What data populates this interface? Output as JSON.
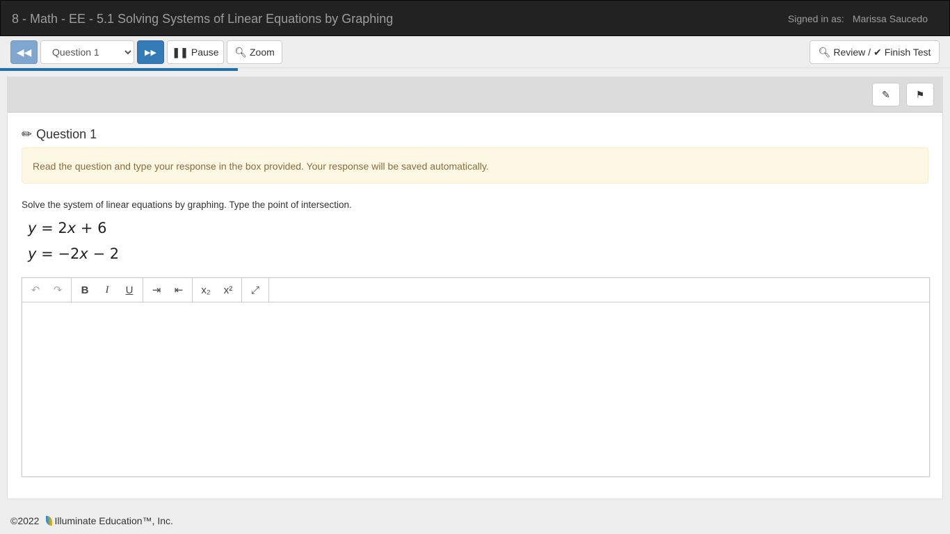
{
  "header": {
    "title": "8 - Math - EE - 5.1 Solving Systems of Linear Equations by Graphing",
    "signed_label": "Signed in as:",
    "user": "Marissa Saucedo"
  },
  "toolbar": {
    "question_select": "Question 1",
    "pause": "Pause",
    "zoom": "Zoom",
    "review": "Review /",
    "finish": "Finish Test",
    "progress_percent": 25
  },
  "question": {
    "title": "Question 1",
    "alert": "Read the question and type your response in the box provided. Your response will be saved automatically.",
    "prompt": "Solve the system of linear equations by graphing. Type the point of intersection.",
    "eq1": {
      "lhs": "y",
      "rest": " = 2",
      "x": "x",
      "tail": " + 6"
    },
    "eq2": {
      "lhs": "y",
      "rest": " = −2",
      "x": "x",
      "tail": " − 2"
    }
  },
  "editor": {
    "response": ""
  },
  "footer": {
    "copyright": "©2022",
    "company": "Illuminate Education™, Inc."
  }
}
